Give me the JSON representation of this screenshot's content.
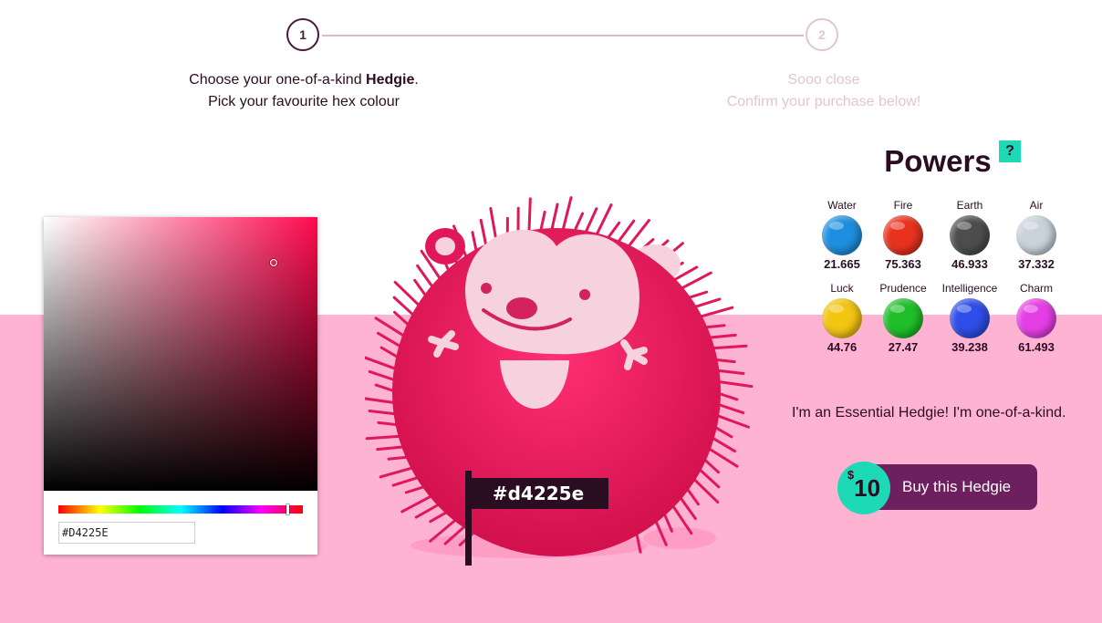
{
  "stepper": {
    "step1": {
      "number": "1",
      "line1_prefix": "Choose your one-of-a-kind ",
      "line1_bold": "Hedgie",
      "line1_suffix": ".",
      "line2": "Pick your favourite hex colour"
    },
    "step2": {
      "number": "2",
      "line1": "Sooo close",
      "line2": "Confirm your purchase below!"
    }
  },
  "picker": {
    "hex_value": "#D4225E",
    "hue_percent": 94,
    "base_hue_color": "#ff0a4e"
  },
  "hedgie": {
    "flag_label": "#d4225e",
    "body_color": "#e0185a"
  },
  "powers": {
    "title": "Powers",
    "help": "?",
    "items": [
      {
        "name": "Water",
        "value": "21.665",
        "color": "#1e8fe0",
        "icon": "water-orb-icon"
      },
      {
        "name": "Fire",
        "value": "75.363",
        "color": "#e8321e",
        "icon": "fire-orb-icon"
      },
      {
        "name": "Earth",
        "value": "46.933",
        "color": "#4d4d4d",
        "icon": "earth-orb-icon"
      },
      {
        "name": "Air",
        "value": "37.332",
        "color": "#c9d3dc",
        "icon": "air-orb-icon"
      },
      {
        "name": "Luck",
        "value": "44.76",
        "color": "#f2c511",
        "icon": "luck-orb-icon"
      },
      {
        "name": "Prudence",
        "value": "27.47",
        "color": "#1fbf2a",
        "icon": "prudence-orb-icon"
      },
      {
        "name": "Intelligence",
        "value": "39.238",
        "color": "#2f4de8",
        "icon": "intelligence-orb-icon"
      },
      {
        "name": "Charm",
        "value": "61.493",
        "color": "#e63ee6",
        "icon": "charm-orb-icon"
      }
    ]
  },
  "tagline": "I'm an Essential Hedgie! I'm one-of-a-kind.",
  "buy": {
    "price_symbol": "$",
    "price": "10",
    "label": "Buy this Hedgie",
    "button_color": "#6e1f5f",
    "price_color": "#1ed9b6"
  }
}
